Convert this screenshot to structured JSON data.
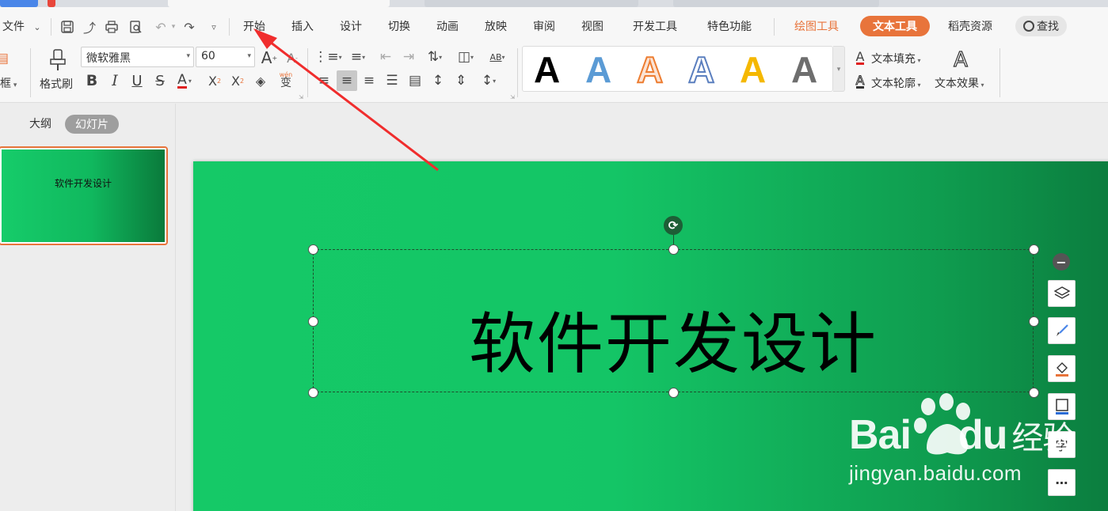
{
  "menubar": {
    "file_label": "文件",
    "items": [
      "开始",
      "插入",
      "设计",
      "切换",
      "动画",
      "放映",
      "审阅",
      "视图",
      "开发工具",
      "特色功能"
    ],
    "drawing_tools": "绘图工具",
    "text_tools": "文本工具",
    "resources": "稻壳资源",
    "search": "查找"
  },
  "ribbon": {
    "textbox_label": "框",
    "format_painter": "格式刷",
    "font_name": "微软雅黑",
    "font_size": "60",
    "text_fill": "文本填充",
    "text_outline": "文本轮廓",
    "text_effect": "文本效果",
    "phonetic_label": "wén",
    "wordart_styles": [
      "A",
      "A",
      "A",
      "A",
      "A",
      "A"
    ]
  },
  "left_panel": {
    "tab_outline": "大纲",
    "tab_slides": "幻灯片",
    "thumbnail_text": "软件开发设计"
  },
  "slide": {
    "title": "软件开发设计"
  },
  "watermark": {
    "brand_b": "Bai",
    "brand_du": "du",
    "brand_cn": "经验",
    "url": "jingyan.baidu.com"
  },
  "colors": {
    "accent": "#e8743b",
    "slide_green": "#15c967",
    "slide_dark_green": "#0b7a3d",
    "arrow_red": "#f02d2d"
  }
}
